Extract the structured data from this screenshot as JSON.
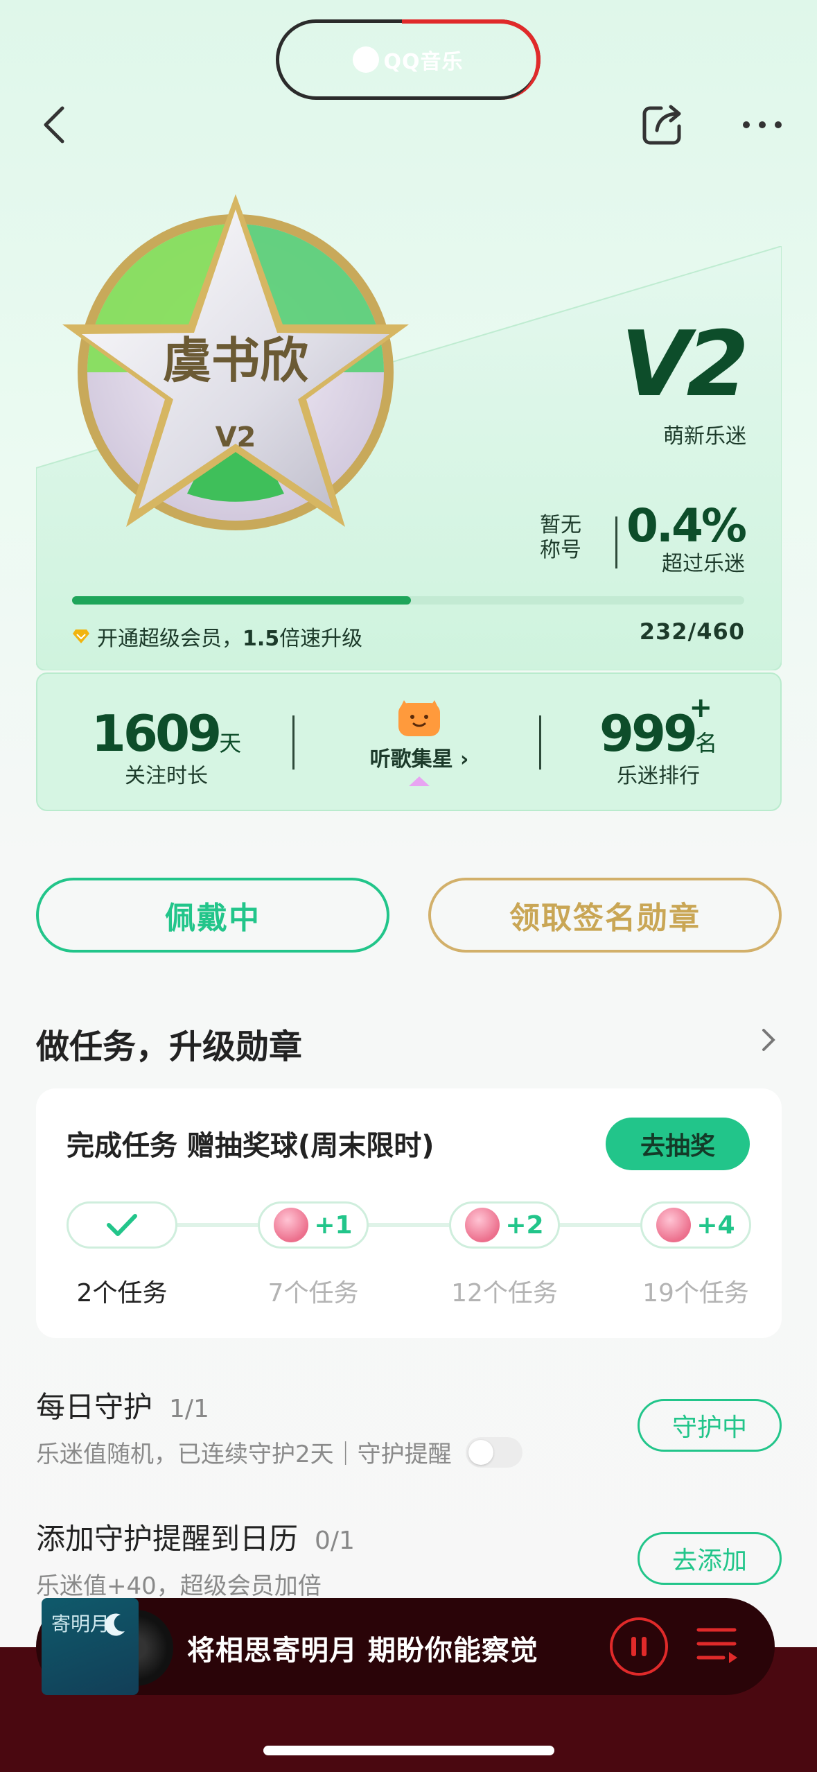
{
  "status_pill": {
    "app_name": "QQ音乐"
  },
  "header": {
    "back": "back",
    "share": "share",
    "more": "more"
  },
  "badge": {
    "name": "虞书欣",
    "level": "V2"
  },
  "level_card": {
    "level": "V2",
    "level_name": "萌新乐迷",
    "title_value": "暂无称号",
    "percent": "0.4%",
    "percent_label": "超过乐迷",
    "progress_current": 232,
    "progress_total": 460,
    "progress_text": "232/460",
    "vip_prefix": "开通超级会员，",
    "vip_bold": "1.5",
    "vip_suffix": "倍速升级"
  },
  "stats": {
    "days": "1609",
    "days_unit": "天",
    "days_label": "关注时长",
    "collect_label": "听歌集星",
    "rank": "999",
    "rank_plus": "+",
    "rank_unit": "名",
    "rank_label": "乐迷排行"
  },
  "actions": {
    "wearing": "佩戴中",
    "claim": "领取签名勋章"
  },
  "tasks_section": {
    "title": "做任务，升级勋章"
  },
  "task_card": {
    "title": "完成任务 赠抽奖球(周末限时)",
    "draw_button": "去抽奖",
    "milestones": [
      {
        "reward": "",
        "label": "2个任务",
        "done": true
      },
      {
        "reward": "+1",
        "label": "7个任务",
        "done": false
      },
      {
        "reward": "+2",
        "label": "12个任务",
        "done": false
      },
      {
        "reward": "+4",
        "label": "19个任务",
        "done": false
      }
    ]
  },
  "task_rows": [
    {
      "title": "每日守护",
      "count": "1/1",
      "desc": "乐迷值随机，已连续守护2天｜守护提醒",
      "button": "守护中"
    },
    {
      "title": "添加守护提醒到日历",
      "count": "0/1",
      "desc": "乐迷值+40，超级会员加倍",
      "button": "去添加"
    }
  ],
  "player": {
    "cover_title": "寄明月",
    "song": "将相思寄明月 期盼你能察觉"
  },
  "colors": {
    "accent_green": "#22c58a",
    "gold": "#d2b06a",
    "dark_green": "#0d4d2a",
    "player_red": "#e02a2a"
  }
}
